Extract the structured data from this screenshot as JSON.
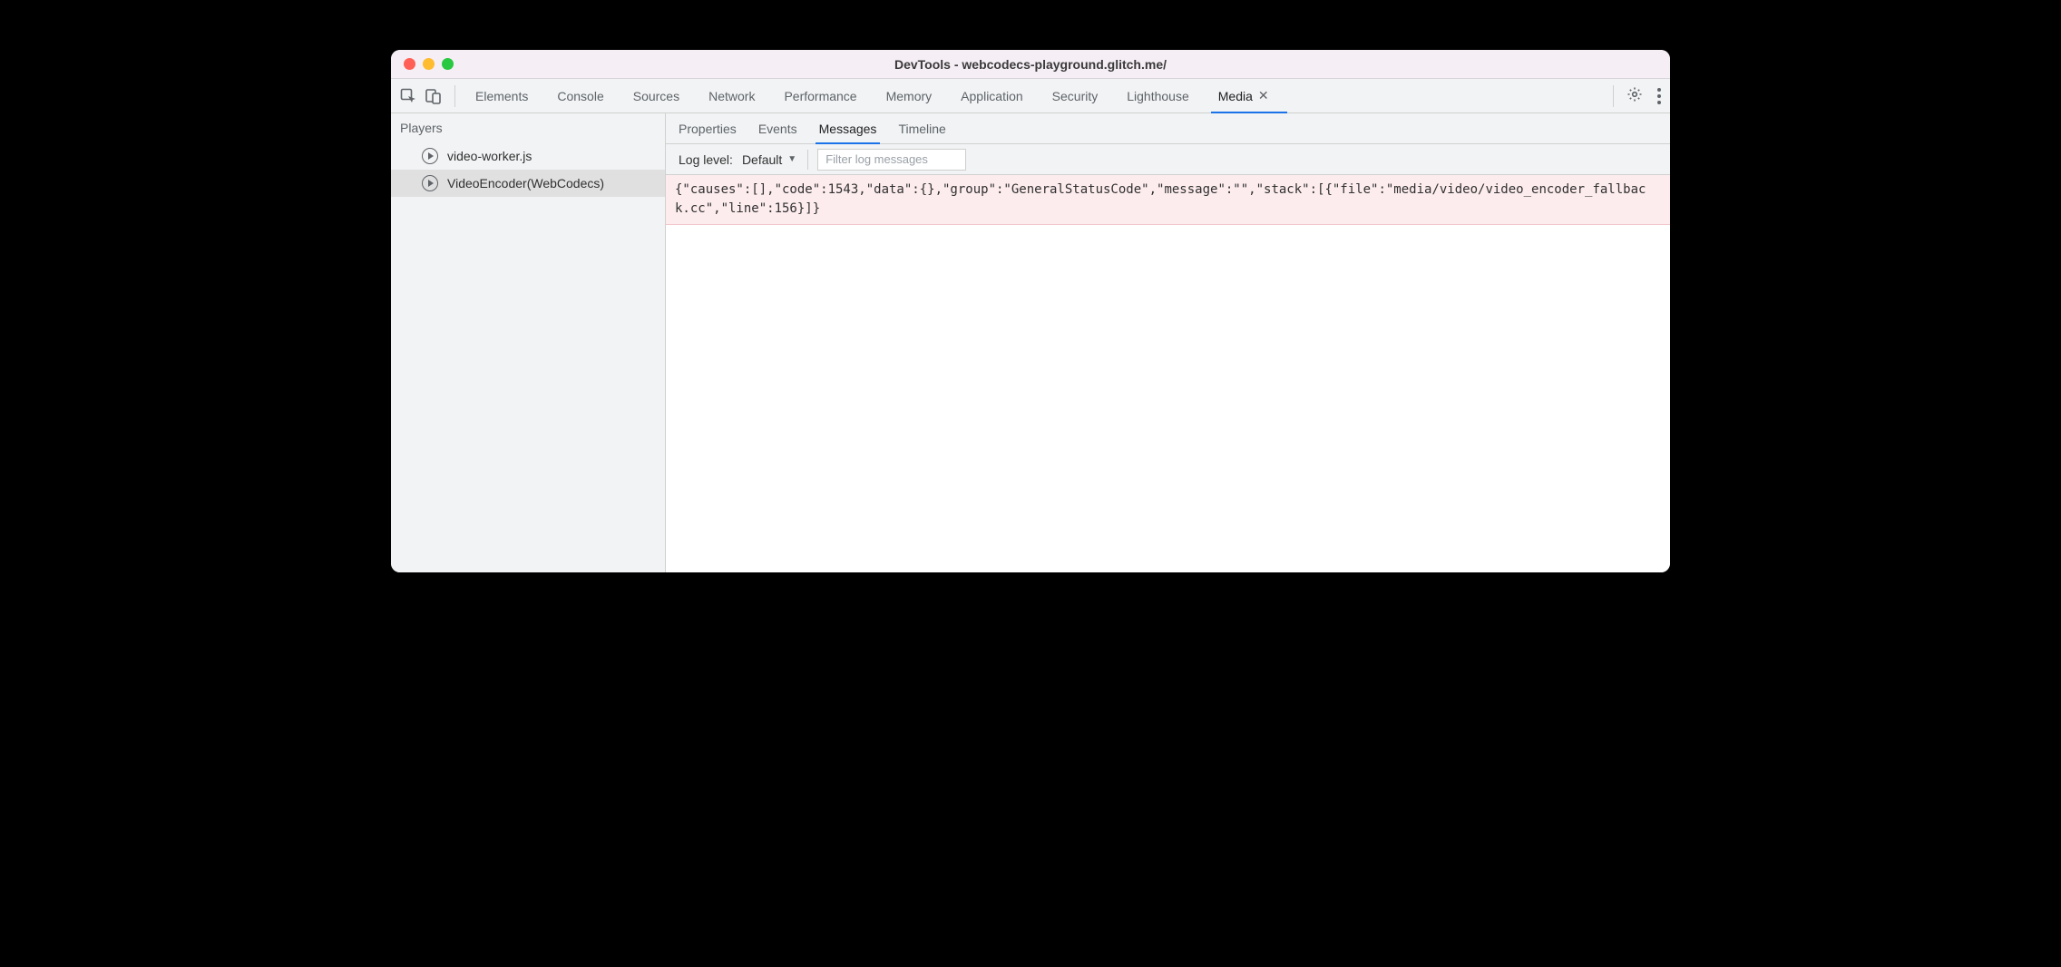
{
  "window": {
    "title": "DevTools - webcodecs-playground.glitch.me/"
  },
  "mainTabs": {
    "items": [
      {
        "label": "Elements"
      },
      {
        "label": "Console"
      },
      {
        "label": "Sources"
      },
      {
        "label": "Network"
      },
      {
        "label": "Performance"
      },
      {
        "label": "Memory"
      },
      {
        "label": "Application"
      },
      {
        "label": "Security"
      },
      {
        "label": "Lighthouse"
      },
      {
        "label": "Media",
        "active": true,
        "closable": true
      }
    ]
  },
  "sidebar": {
    "header": "Players",
    "items": [
      {
        "label": "video-worker.js",
        "selected": false
      },
      {
        "label": "VideoEncoder(WebCodecs)",
        "selected": true
      }
    ]
  },
  "subTabs": {
    "items": [
      {
        "label": "Properties"
      },
      {
        "label": "Events"
      },
      {
        "label": "Messages",
        "active": true
      },
      {
        "label": "Timeline"
      }
    ]
  },
  "filterBar": {
    "logLevelLabel": "Log level:",
    "logLevelValue": "Default",
    "filterPlaceholder": "Filter log messages"
  },
  "messages": {
    "items": [
      {
        "text": "{\"causes\":[],\"code\":1543,\"data\":{},\"group\":\"GeneralStatusCode\",\"message\":\"\",\"stack\":[{\"file\":\"media/video/video_encoder_fallback.cc\",\"line\":156}]}"
      }
    ]
  }
}
